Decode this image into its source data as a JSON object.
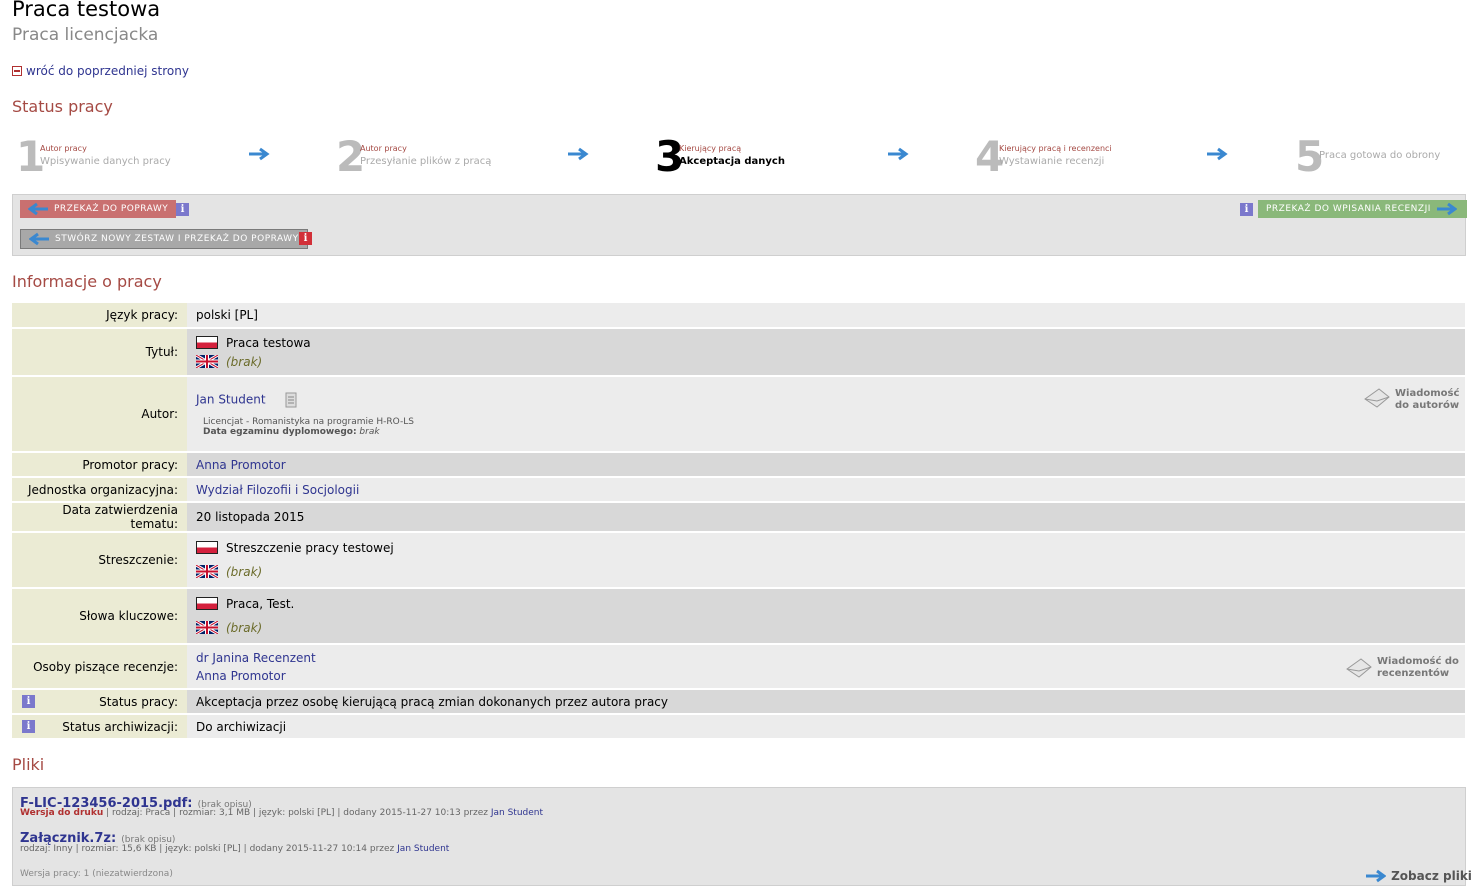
{
  "header": {
    "title": "Praca testowa",
    "subtitle": "Praca licencjacka",
    "back_link": "wróć do poprzedniej strony"
  },
  "status": {
    "heading": "Status pracy",
    "steps": [
      {
        "num": "1",
        "role": "Autor pracy",
        "label": "Wpisywanie danych pracy",
        "active": false
      },
      {
        "num": "2",
        "role": "Autor pracy",
        "label": "Przesyłanie plików z pracą",
        "active": false
      },
      {
        "num": "3",
        "role": "Kierujący pracą",
        "label": "Akceptacja danych",
        "active": true
      },
      {
        "num": "4",
        "role": "Kierujący pracą i recenzenci",
        "label": "Wystawianie recenzji",
        "active": false
      },
      {
        "num": "5",
        "role": "",
        "label": "Praca gotowa do obrony",
        "active": false
      }
    ],
    "buttons": {
      "return_for_correction": "PRZEKAŻ DO POPRAWY",
      "new_set_return": "STWÓRZ NOWY ZESTAW I PRZEKAŻ DO POPRAWY",
      "forward_to_review": "PRZEKAŻ DO WPISANIA RECENZJI"
    },
    "colors": {
      "accent": "#a54a44",
      "red_button": "#c97070",
      "green_button": "#8ab87a",
      "arrow": "#3a88d0"
    }
  },
  "info": {
    "heading": "Informacje o pracy",
    "language_label": "Język pracy:",
    "language_value": "polski [PL]",
    "title_label": "Tytuł:",
    "title_pl": "Praca testowa",
    "title_en": "(brak)",
    "author_label": "Autor:",
    "author_name": "Jan Student",
    "author_program": "Licencjat - Romanistyka na programie H-RO-LS",
    "exam_date_label": "Data egzaminu dyplomowego:",
    "exam_date_value": "brak",
    "msg_authors_line1": "Wiadomość",
    "msg_authors_line2": "do autorów",
    "promoter_label": "Promotor pracy:",
    "promoter_value": "Anna Promotor",
    "unit_label": "Jednostka organizacyjna:",
    "unit_value": "Wydział Filozofii i Socjologii",
    "approval_label": "Data zatwierdzenia tematu:",
    "approval_value": "20 listopada 2015",
    "abstract_label": "Streszczenie:",
    "abstract_pl": "Streszczenie pracy testowej",
    "abstract_en": "(brak)",
    "keywords_label": "Słowa kluczowe:",
    "keywords_pl": "Praca, Test.",
    "keywords_en": "(brak)",
    "reviewers_label": "Osoby piszące recenzje:",
    "reviewer_1": "dr Janina Recenzent",
    "reviewer_2": "Anna Promotor",
    "msg_reviewers_line1": "Wiadomość do",
    "msg_reviewers_line2": "recenzentów",
    "work_status_label": "Status pracy:",
    "work_status_value": "Akceptacja przez osobę kierującą pracą zmian dokonanych przez autora pracy",
    "archive_status_label": "Status archiwizacji:",
    "archive_status_value": "Do archiwizacji"
  },
  "files": {
    "heading": "Pliki",
    "file1_name": "F-LIC-123456-2015.pdf:",
    "file1_desc": "(brak opisu)",
    "file1_print": "Wersja do druku",
    "file1_meta": "| rodzaj: Praca | rozmiar: 3,1 MB | język: polski [PL] | dodany 2015-11-27 10:13 przez",
    "file1_author": "Jan Student",
    "file2_name": "Załącznik.7z:",
    "file2_desc": "(brak opisu)",
    "file2_meta": "rodzaj: Inny | rozmiar: 15,6 KB | język: polski [PL] | dodany 2015-11-27 10:14 przez",
    "file2_author": "Jan Student",
    "version": "Wersja pracy: 1 (niezatwierdzona)",
    "view_files": "Zobacz pliki"
  }
}
